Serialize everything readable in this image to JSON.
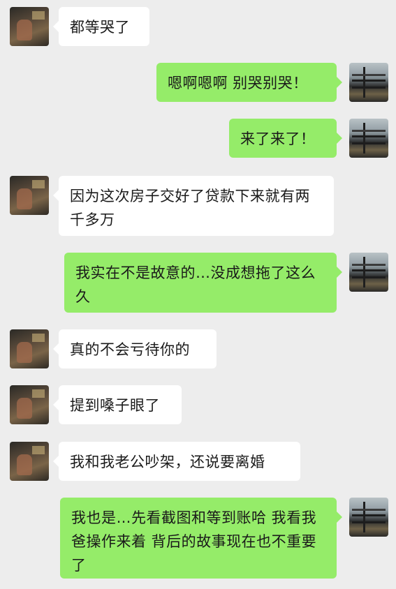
{
  "colors": {
    "background": "#ededed",
    "incoming_bubble": "#ffffff",
    "outgoing_bubble": "#95ec69",
    "text": "#1a1a1a"
  },
  "messages": [
    {
      "side": "left",
      "text": "都等哭了"
    },
    {
      "side": "right",
      "text": "嗯啊嗯啊 别哭别哭！"
    },
    {
      "side": "right",
      "text": "来了来了！"
    },
    {
      "side": "left",
      "text": "因为这次房子交好了贷款下来就有两千多万"
    },
    {
      "side": "right",
      "text": "我实在不是故意的…没成想拖了这么久"
    },
    {
      "side": "left",
      "text": "真的不会亏待你的"
    },
    {
      "side": "left",
      "text": "提到嗓子眼了"
    },
    {
      "side": "left",
      "text": "我和我老公吵架，还说要离婚"
    },
    {
      "side": "right",
      "text": "我也是…先看截图和等到账哈 我看我爸操作来着 背后的故事现在也不重要了"
    }
  ]
}
